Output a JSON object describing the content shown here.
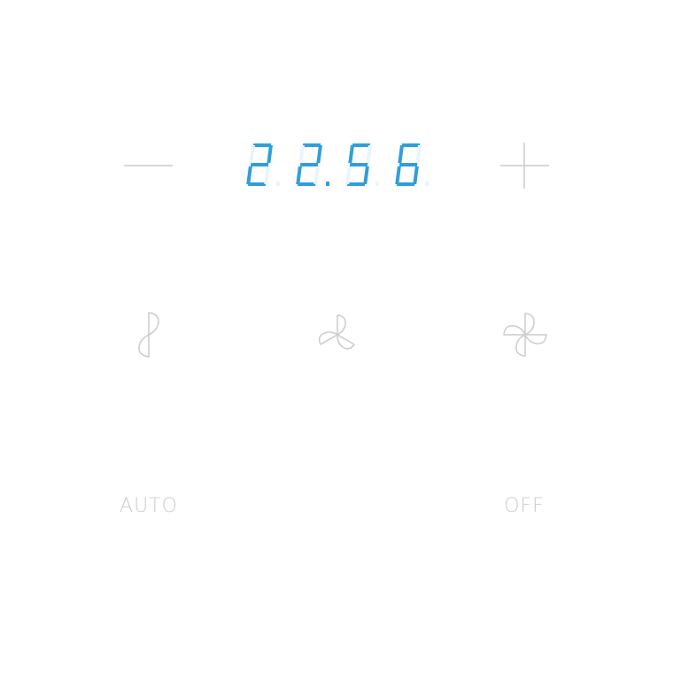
{
  "thermostat": {
    "temperature_display": "22.56",
    "digits": [
      "2",
      "2",
      "5",
      "6"
    ],
    "decimal_after_digit": 2,
    "display_color": "#2f9edd",
    "ghost_segment_color": "#eaf4fb",
    "control_color": "#cccccc"
  },
  "controls": {
    "decrease_icon": "minus-icon",
    "increase_icon": "plus-icon"
  },
  "fan_speeds": [
    {
      "name": "low",
      "icon": "fan-low-icon",
      "blades": 2
    },
    {
      "name": "medium",
      "icon": "fan-medium-icon",
      "blades": 3
    },
    {
      "name": "high",
      "icon": "fan-high-icon",
      "blades": 4
    }
  ],
  "modes": {
    "auto_label": "AUTO",
    "off_label": "OFF"
  }
}
